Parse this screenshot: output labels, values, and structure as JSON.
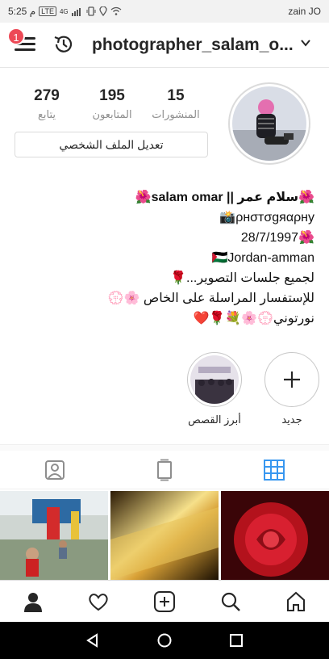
{
  "statusbar": {
    "time": "5:25 م",
    "carrier": "zain JO",
    "lte": "4G",
    "volte": "LTE"
  },
  "header": {
    "username": "photographer_salam_o...",
    "notif_count": "1"
  },
  "stats": [
    {
      "num": "279",
      "label": "يتابع"
    },
    {
      "num": "195",
      "label": "المتابعون"
    },
    {
      "num": "15",
      "label": "المنشورات"
    }
  ],
  "edit_profile_label": "تعديل الملف الشخصي",
  "bio": {
    "name_line": "🌺سلام عمر || salam omar🌺",
    "line2": "ρнσтσgяαρну📸",
    "line3": "🌺28/7/1997",
    "line4": "🇵🇸Jordan-amman",
    "line5": "لجميع جلسات التصوير...🌹",
    "line6": "للإستفسار المراسلة على الخاص 🌸💮",
    "line7": "نورتوني💮🌸💐🌹❤️"
  },
  "highlights": {
    "new_label": "جديد",
    "story_label": "أبرز القصص"
  },
  "colors": {
    "accent": "#3897f0",
    "badge": "#ed4956"
  },
  "icons": {
    "menu": "hamburger-menu-icon",
    "history": "archive-clock-icon",
    "chevron": "chevron-down-icon",
    "tab_tagged": "tagged-icon",
    "tab_igtv": "igtv-icon",
    "tab_grid": "grid-icon",
    "nav_profile": "profile-icon",
    "nav_activity": "heart-icon",
    "nav_add": "add-post-icon",
    "nav_search": "search-icon",
    "nav_home": "home-icon"
  }
}
